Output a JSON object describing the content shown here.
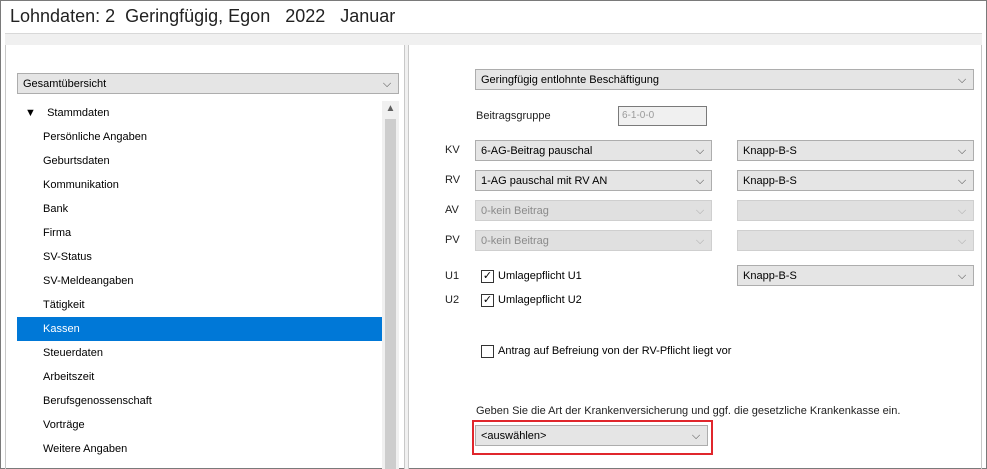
{
  "window": {
    "title": "Lohndaten: 2  Geringfügig, Egon   2022   Januar"
  },
  "left_panel": {
    "overview_select": "Gesamtübersicht",
    "tree": {
      "root_toggle": "▼",
      "root_label": "Stammdaten",
      "items": [
        "Persönliche Angaben",
        "Geburtsdaten",
        "Kommunikation",
        "Bank",
        "Firma",
        "SV-Status",
        "SV-Meldeangaben",
        "Tätigkeit",
        "Kassen",
        "Steuerdaten",
        "Arbeitszeit",
        "Berufsgenossenschaft",
        "Vorträge",
        "Weitere Angaben"
      ],
      "selected": "Kassen"
    }
  },
  "right_panel": {
    "employment_type": "Geringfügig entlohnte Beschäftigung",
    "beitragsgruppe_label": "Beitragsgruppe",
    "beitragsgruppe_value": "6-1-0-0",
    "rows": {
      "kv": {
        "label": "KV",
        "value": "6-AG-Beitrag pauschal",
        "kasse": "Knapp-B-S"
      },
      "rv": {
        "label": "RV",
        "value": "1-AG pauschal mit RV AN",
        "kasse": "Knapp-B-S"
      },
      "av": {
        "label": "AV",
        "value": "0-kein Beitrag",
        "kasse": ""
      },
      "pv": {
        "label": "PV",
        "value": "0-kein Beitrag",
        "kasse": ""
      }
    },
    "u1": {
      "label": "U1",
      "check_label": "Umlagepflicht U1",
      "checked": true,
      "kasse": "Knapp-B-S"
    },
    "u2": {
      "label": "U2",
      "check_label": "Umlagepflicht U2",
      "checked": true
    },
    "rv_exemption": {
      "label": "Antrag auf Befreiung von der RV-Pflicht liegt vor",
      "checked": false
    },
    "hint": "Geben Sie die Art der Krankenversicherung und ggf. die gesetzliche Krankenkasse ein.",
    "kv_type_select": "<auswählen>"
  },
  "icons": {
    "dropdown": "chevron-down-icon",
    "check": "✓",
    "scroll_up": "▲"
  },
  "colors": {
    "selection": "#0078d7",
    "highlight": "#e0262c"
  }
}
